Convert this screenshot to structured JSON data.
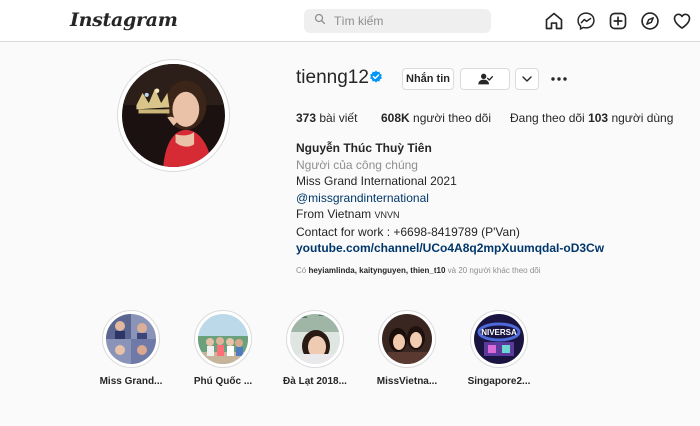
{
  "header": {
    "logo": "Instagram",
    "search": {
      "placeholder": "Tìm kiếm"
    },
    "nav_icons": [
      "home-icon",
      "messenger-icon",
      "new-post-icon",
      "explore-icon",
      "activity-heart-icon"
    ]
  },
  "profile": {
    "username": "tienng12",
    "verified": true,
    "message_button": "Nhắn tin",
    "stats": {
      "posts_count": "373",
      "posts_label": "bài viết",
      "followers_count": "608K",
      "followers_label": "người theo dõi",
      "following_prefix": "Đang theo dõi",
      "following_count": "103",
      "following_suffix": "người dùng"
    },
    "bio": {
      "full_name": "Nguyễn Thúc Thuỳ Tiên",
      "category": "Người của công chúng",
      "line1": "Miss Grand International 2021",
      "mention": "@missgrandinternational",
      "from": "From Vietnam",
      "flag": "VNVN",
      "contact": "Contact for work : +6698-8419789 (P'Van)",
      "link": "youtube.com/channel/UCo4A8q2mpXuumqdaI-oD3Cw"
    },
    "followed_by": {
      "prefix": "Có",
      "names": "heyiamlinda, kaitynguyen, thien_t10",
      "suffix": "và 20 người khác theo dõi"
    }
  },
  "highlights": [
    {
      "label": "Miss Grand..."
    },
    {
      "label": "Phú Quốc ..."
    },
    {
      "label": "Đà Lạt 2018..."
    },
    {
      "label": "MissVietna..."
    },
    {
      "label": "Singapore2..."
    }
  ],
  "colors": {
    "background": "#fafafa",
    "border": "#dbdbdb",
    "verified_blue": "#0095f6",
    "link": "#00376b",
    "muted": "#8e8e8e"
  }
}
